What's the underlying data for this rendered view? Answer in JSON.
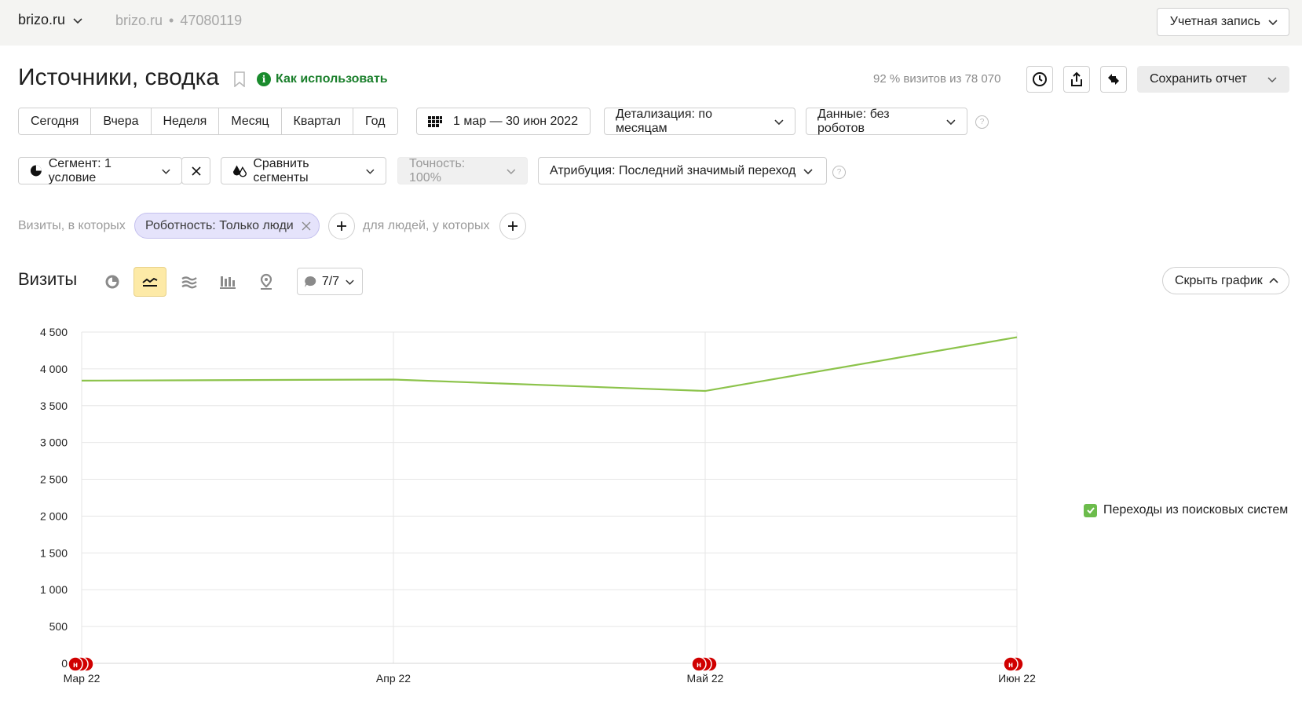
{
  "header": {
    "site": "brizo.ru",
    "site_sub": "brizo.ru",
    "counter_id": "47080119",
    "account_label": "Учетная запись"
  },
  "report": {
    "title": "Источники, сводка",
    "howto": "Как использовать",
    "visits_stat": "92 % визитов из 78 070",
    "save_label": "Сохранить отчет"
  },
  "periods": [
    "Сегодня",
    "Вчера",
    "Неделя",
    "Месяц",
    "Квартал",
    "Год"
  ],
  "filters": {
    "date_range": "1 мар — 30 июн 2022",
    "detail": "Детализация: по месяцам",
    "data": "Данные: без роботов",
    "segment": "Сегмент: 1 условие",
    "compare": "Сравнить сегменты",
    "accuracy": "Точность: 100%",
    "attribution": "Атрибуция: Последний значимый переход"
  },
  "conditions": {
    "visits_label": "Визиты, в которых",
    "chip": "Роботность: Только люди",
    "people_label": "для людей, у которых"
  },
  "chart_section": {
    "title": "Визиты",
    "notes": "7/7",
    "hide_label": "Скрыть график"
  },
  "colors": {
    "line": "#8cc34b",
    "active_view": "#fdeaa7",
    "note_marker": "#d00000",
    "accent_green": "#1a7f2b"
  },
  "chart_data": {
    "type": "line",
    "x": [
      "Мар 22",
      "Апр 22",
      "Май 22",
      "Июн 22"
    ],
    "series": [
      {
        "name": "Переходы из поисковых систем",
        "values": [
          3840,
          3855,
          3700,
          4430
        ]
      }
    ],
    "ylim": [
      0,
      4500
    ],
    "yticks": [
      0,
      500,
      1000,
      1500,
      2000,
      2500,
      3000,
      3500,
      4000,
      4500
    ],
    "ytick_labels": [
      "0",
      "500",
      "1 000",
      "1 500",
      "2 000",
      "2 500",
      "3 000",
      "3 500",
      "4 000",
      "4 500"
    ],
    "grid": true,
    "legend": "right",
    "note_marker_label": "н",
    "note_markers": [
      {
        "x_index": 0,
        "count": 3
      },
      {
        "x_index": 2,
        "count": 3
      },
      {
        "x_index": 3,
        "count": 2
      }
    ]
  }
}
